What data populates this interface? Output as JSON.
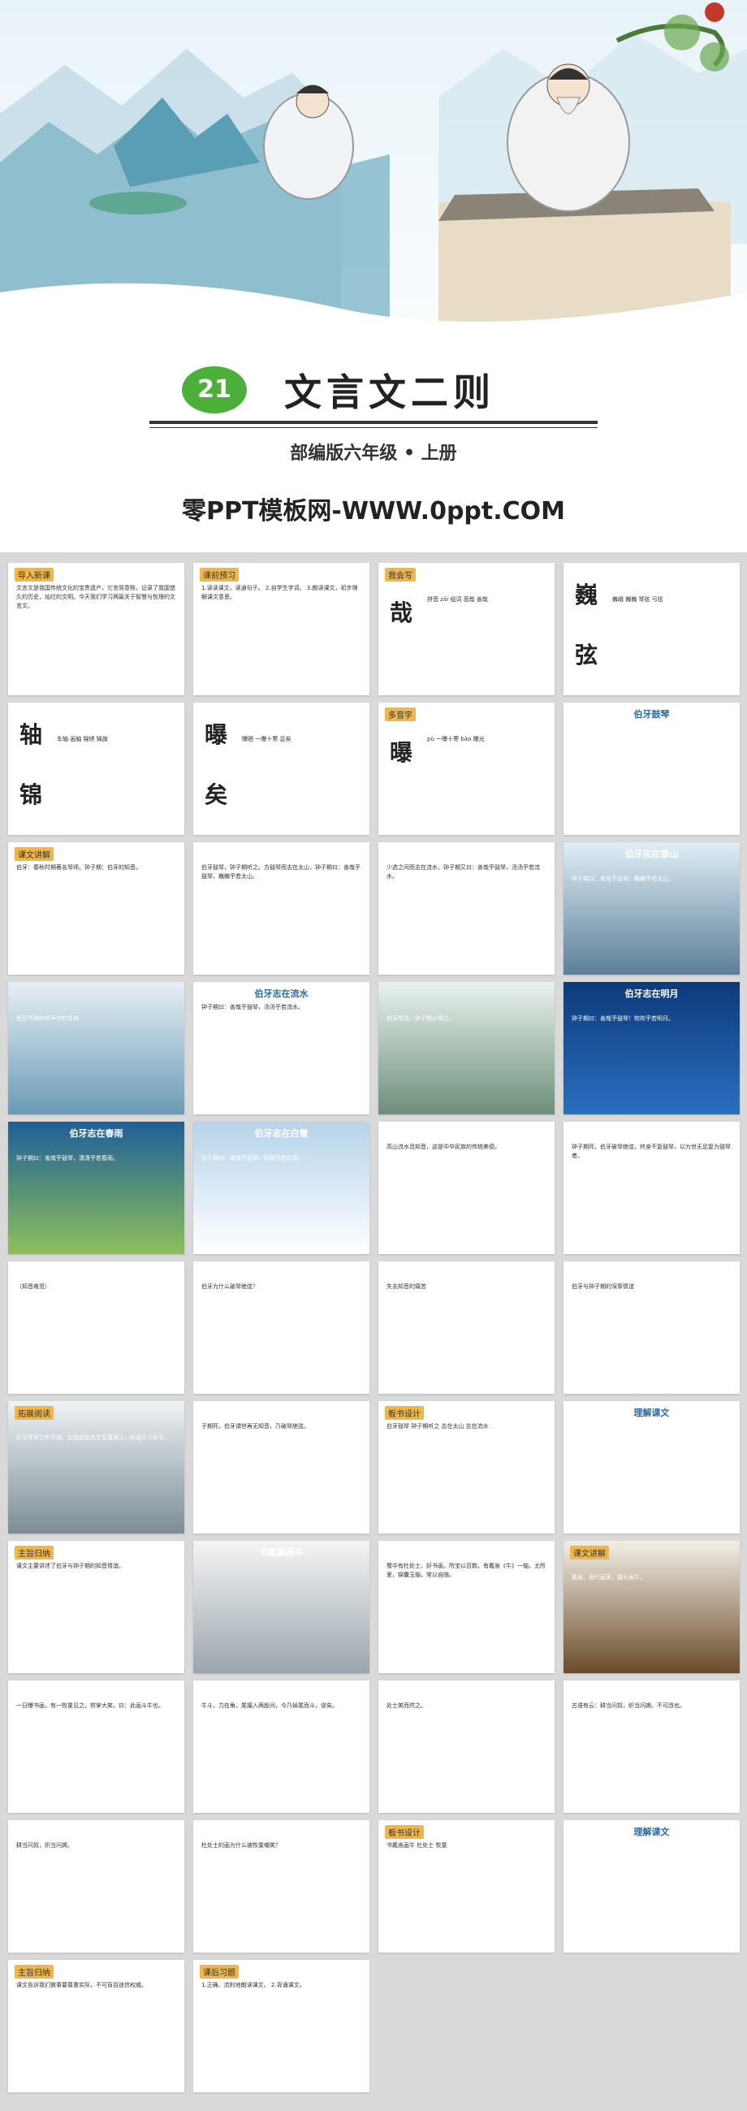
{
  "cover": {
    "lesson_number": "21",
    "title": "文言文二则",
    "subtitle": "部编版六年级 • 上册",
    "watermark": "零PPT模板网-WWW.0ppt.COM"
  },
  "slides": [
    {
      "label": "导入新课",
      "text": "文言文是我国传统文化的宝贵遗产，它言简意赅，记录了我国悠久的历史，灿烂的文明。今天我们学习两篇关于智慧与哲理的文言文。"
    },
    {
      "label": "课前预习",
      "text": "1.读读课文，读通句子。 2.自学生字词。 3.朗读课文，初步理解课文意思。"
    },
    {
      "label": "我会写",
      "char": "哉",
      "text": "拼音 zāi 组词 悲哉 善哉"
    },
    {
      "label": "",
      "char": "巍",
      "char2": "弦",
      "text": "巍峨 巍巍 琴弦 弓弦"
    },
    {
      "label": "",
      "char": "轴",
      "char2": "锦",
      "text": "车轴 画轴 锦绣 锦旗"
    },
    {
      "label": "",
      "char": "曝",
      "char2": "矣",
      "text": "曝晒 一曝十寒 足矣"
    },
    {
      "label": "多音字",
      "char": "曝",
      "text": "pù 一曝十寒 bào 曝光"
    },
    {
      "label": "",
      "heading": "伯牙鼓琴",
      "text": ""
    },
    {
      "label": "课文讲解",
      "text": "伯牙：春秋时期著名琴师。钟子期：伯牙的知音。"
    },
    {
      "label": "",
      "text": "伯牙鼓琴，钟子期听之。方鼓琴而志在太山，钟子期曰：善哉乎鼓琴，巍巍乎若太山。"
    },
    {
      "label": "",
      "text": "少选之间而志在流水，钟子期又曰：善哉乎鼓琴，汤汤乎若流水。"
    },
    {
      "label": "",
      "heading": "伯牙志在泰山",
      "text": "钟子期曰：善哉乎鼓琴！巍巍乎若太山。"
    },
    {
      "label": "",
      "text": "伯牙所弹的琴声中的意境"
    },
    {
      "label": "",
      "heading": "伯牙志在流水",
      "text": "钟子期曰：善哉乎鼓琴，汤汤乎若流水。"
    },
    {
      "label": "",
      "text": "伯牙所念，钟子期必得之。"
    },
    {
      "label": "",
      "heading": "伯牙志在明月",
      "text": "钟子期曰：善哉乎鼓琴！皎皎乎若明月。"
    },
    {
      "label": "",
      "heading": "伯牙志在春雨",
      "text": "钟子期曰：善哉乎鼓琴，潇潇乎若春雨。"
    },
    {
      "label": "",
      "heading": "伯牙志在白雪",
      "text": "钟子期曰：善哉乎鼓琴，皑皑乎若白雪。"
    },
    {
      "label": "",
      "text": "高山流水觅知音，这是中华民族的传统美德。"
    },
    {
      "label": "",
      "text": "钟子期死，伯牙破琴绝弦，终身不复鼓琴，以为世无足复为鼓琴者。"
    },
    {
      "label": "",
      "text": "（知音难觅）"
    },
    {
      "label": "",
      "text": "伯牙为什么破琴绝弦？"
    },
    {
      "label": "",
      "text": "失去知音的痛苦"
    },
    {
      "label": "",
      "text": "伯牙与钟子期的深厚情谊"
    },
    {
      "label": "拓展阅读",
      "text": "伯牙学琴三年不成，后随成连先生至蓬莱山，终成天下妙手。"
    },
    {
      "label": "",
      "text": "子期死，伯牙谓世再无知音，乃破琴绝弦。"
    },
    {
      "label": "板书设计",
      "text": "伯牙鼓琴 钟子期听之 志在太山 志在流水"
    },
    {
      "label": "",
      "heading": "理解课文",
      "text": ""
    },
    {
      "label": "主旨归纳",
      "text": "课文主要讲述了伯牙与钟子期的知音情谊。"
    },
    {
      "label": "",
      "heading": "书戴嵩画牛",
      "text": ""
    },
    {
      "label": "",
      "text": "蜀中有杜处士，好书画，所宝以百数。有戴嵩《牛》一轴，尤所爱，锦囊玉轴，常以自随。"
    },
    {
      "label": "课文讲解",
      "text": "戴嵩，唐代画家，擅长画牛。"
    },
    {
      "label": "",
      "text": "一日曝书画，有一牧童见之，拊掌大笑，曰：此画斗牛也。"
    },
    {
      "label": "",
      "text": "牛斗，力在角，尾搐入两股间，今乃掉尾而斗，谬矣。"
    },
    {
      "label": "",
      "text": "处士笑而然之。"
    },
    {
      "label": "",
      "text": "古语有云：耕当问奴，织当问婢。不可改也。"
    },
    {
      "label": "",
      "text": "耕当问奴，织当问婢。"
    },
    {
      "label": "",
      "text": "杜处士的画为什么被牧童嘲笑？"
    },
    {
      "label": "板书设计",
      "text": "书戴嵩画牛 杜处士 牧童"
    },
    {
      "label": "",
      "heading": "理解课文",
      "text": ""
    },
    {
      "label": "主旨归纳",
      "text": "课文告诉我们做事要尊重实际，不可盲目迷信权威。"
    },
    {
      "label": "课后习题",
      "text": "1.正确、流利地朗读课文。 2.背诵课文。"
    }
  ]
}
